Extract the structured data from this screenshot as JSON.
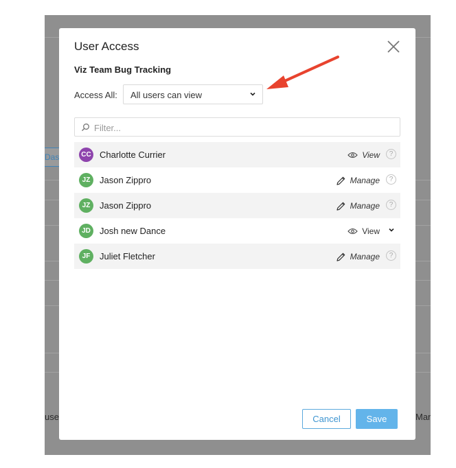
{
  "background": {
    "tab_fragment": "Dash",
    "left_fragment": "user",
    "right_fragment": "Mana"
  },
  "modal": {
    "title": "User Access",
    "subtitle": "Viz Team Bug Tracking",
    "access_all_label": "Access All:",
    "access_all_value": "All users can view",
    "filter_placeholder": "Filter...",
    "users": [
      {
        "initials": "CC",
        "name": "Charlotte Currier",
        "permission": "View",
        "icon": "eye-icon",
        "trailing": "help",
        "color": "#8e44ad"
      },
      {
        "initials": "JZ",
        "name": "Jason Zippro",
        "permission": "Manage",
        "icon": "pencil-icon",
        "trailing": "help",
        "color": "#5fb061"
      },
      {
        "initials": "JZ",
        "name": "Jason Zippro",
        "permission": "Manage",
        "icon": "pencil-icon",
        "trailing": "help",
        "color": "#5fb061"
      },
      {
        "initials": "JD",
        "name": "Josh new Dance",
        "permission": "View",
        "icon": "eye-icon",
        "trailing": "dropdown",
        "color": "#5fb061"
      },
      {
        "initials": "JF",
        "name": "Juliet Fletcher",
        "permission": "Manage",
        "icon": "pencil-icon",
        "trailing": "help",
        "color": "#5fb061"
      }
    ],
    "help_glyph": "?",
    "cancel_label": "Cancel",
    "save_label": "Save"
  },
  "colors": {
    "arrow": "#e8432e",
    "primary": "#63b4ea",
    "backdrop": "#8f8f8f"
  }
}
